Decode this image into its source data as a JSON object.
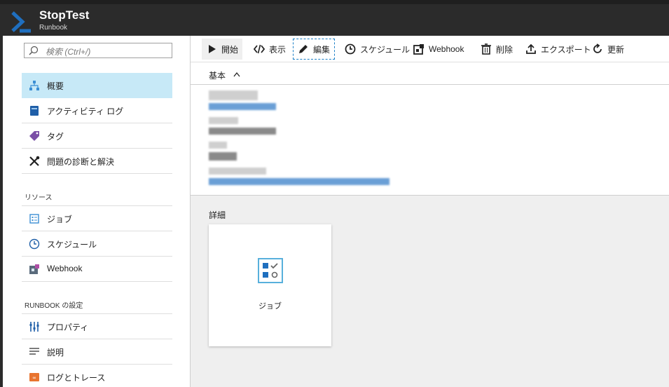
{
  "header": {
    "title": "StopTest",
    "subtitle": "Runbook"
  },
  "search": {
    "placeholder": "検索 (Ctrl+/)"
  },
  "sidebar": {
    "items": [
      {
        "label": "概要",
        "icon": "hierarchy-icon",
        "active": true
      },
      {
        "label": "アクティビティ ログ",
        "icon": "activity-log-icon"
      },
      {
        "label": "タグ",
        "icon": "tag-icon"
      },
      {
        "label": "問題の診断と解決",
        "icon": "wrench-icon"
      }
    ],
    "section_resources": "リソース",
    "resource_items": [
      {
        "label": "ジョブ",
        "icon": "jobs-icon"
      },
      {
        "label": "スケジュール",
        "icon": "clock-icon"
      },
      {
        "label": "Webhook",
        "icon": "webhook-icon"
      }
    ],
    "section_settings": "RUNBOOK の設定",
    "settings_items": [
      {
        "label": "プロパティ",
        "icon": "properties-icon"
      },
      {
        "label": "説明",
        "icon": "description-icon"
      },
      {
        "label": "ログとトレース",
        "icon": "log-trace-icon"
      }
    ]
  },
  "toolbar": {
    "start": "開始",
    "view": "表示",
    "edit": "編集",
    "schedule": "スケジュール",
    "webhook": "Webhook",
    "delete": "削除",
    "export": "エクスポート",
    "refresh": "更新"
  },
  "essentials": {
    "label": "基本"
  },
  "details": {
    "label": "詳細",
    "tile_label": "ジョブ"
  },
  "colors": {
    "topbar": "#2b2b2b",
    "accent": "#1b6fc2",
    "active_nav": "#c7e9f7",
    "details_bg": "#efefef"
  }
}
